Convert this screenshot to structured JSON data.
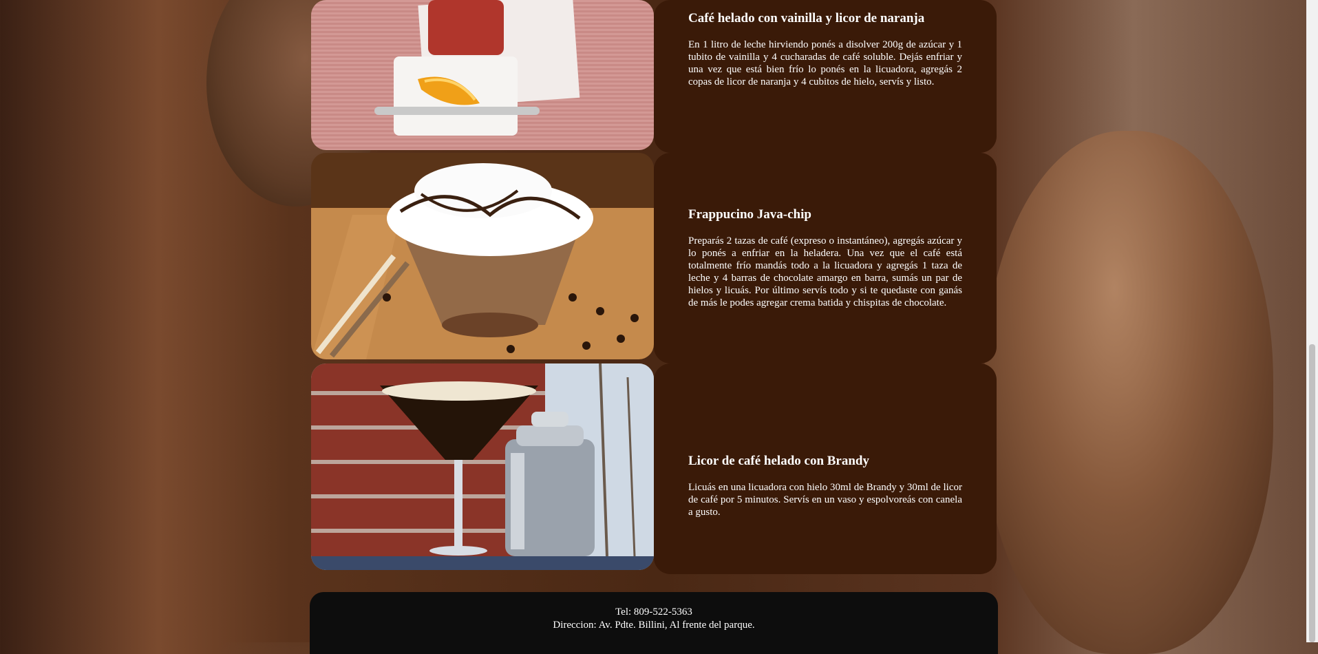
{
  "recipes": [
    {
      "title": "Café helado con vainilla y licor de naranja",
      "text": "En 1 litro de leche hirviendo ponés a disolver 200g de azúcar y 1 tubito de vainilla y 4 cucharadas de café soluble. Dejás enfriar y una vez que está bien frío lo ponés en la licuadora, agregás 2 copas de licor de naranja y 4 cubitos de hielo, servís y listo."
    },
    {
      "title": "Frappucino Java-chip",
      "text": "Preparás 2 tazas de café (expreso o instantáneo), agregás azúcar y lo ponés a enfriar en la heladera. Una vez que el café está totalmente frío mandás todo a la licuadora y agregás 1 taza de leche y 4 barras de chocolate amargo en barra, sumás un par de hielos y licuás. Por último servís todo y si te quedaste con ganás de más le podes agregar crema batida y chispitas de chocolate."
    },
    {
      "title": "Licor de café helado con Brandy",
      "text": "Licuás en una licuadora con hielo 30ml de Brandy y 30ml de licor de café por 5 minutos. Servís en un vaso y espolvoreás con canela a gusto."
    }
  ],
  "footer": {
    "phone": "Tel: 809-522-5363",
    "address": "Direccion: Av. Pdte. Billini, Al frente del parque."
  },
  "colors": {
    "card_background": "#3a1a08",
    "footer_background": "#0d0d0d",
    "text": "#ffffff"
  }
}
